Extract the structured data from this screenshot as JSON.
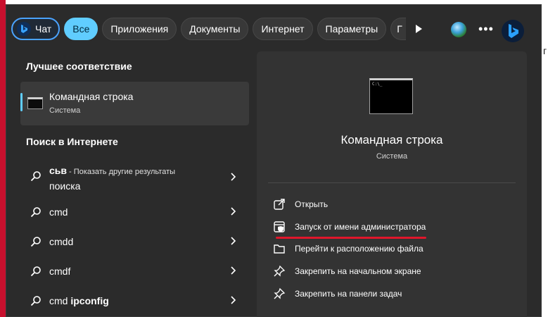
{
  "filters": {
    "chat": "Чат",
    "all": "Все",
    "apps": "Приложения",
    "docs": "Документы",
    "internet": "Интернет",
    "settings": "Параметры",
    "cut": "Г"
  },
  "left": {
    "best_match_title": "Лучшее соответствие",
    "best_match": {
      "name": "Командная строка",
      "sub": "Система"
    },
    "web_title": "Поиск в Интернете",
    "web_items": [
      {
        "bold": "сьв",
        "text": " - Показать другие результаты",
        "line2": "поиска"
      },
      {
        "bold": "",
        "text": "cmd"
      },
      {
        "bold": "",
        "text": "cmdd"
      },
      {
        "bold": "",
        "text": "cmdf"
      },
      {
        "bold": "ipconfig",
        "text": "cmd "
      }
    ]
  },
  "detail": {
    "title": "Командная строка",
    "sub": "Система",
    "actions": [
      {
        "label": "Открыть",
        "icon": "open-icon"
      },
      {
        "label": "Запуск от имени администратора",
        "icon": "admin-shield-icon"
      },
      {
        "label": "Перейти к расположению файла",
        "icon": "folder-icon"
      },
      {
        "label": "Закрепить на начальном экране",
        "icon": "pin-icon"
      },
      {
        "label": "Закрепить на панели задач",
        "icon": "pin-icon"
      }
    ]
  },
  "colors": {
    "accent": "#60cdff",
    "highlight_underline": "#e0162b",
    "panel": "#2b2b2b"
  }
}
